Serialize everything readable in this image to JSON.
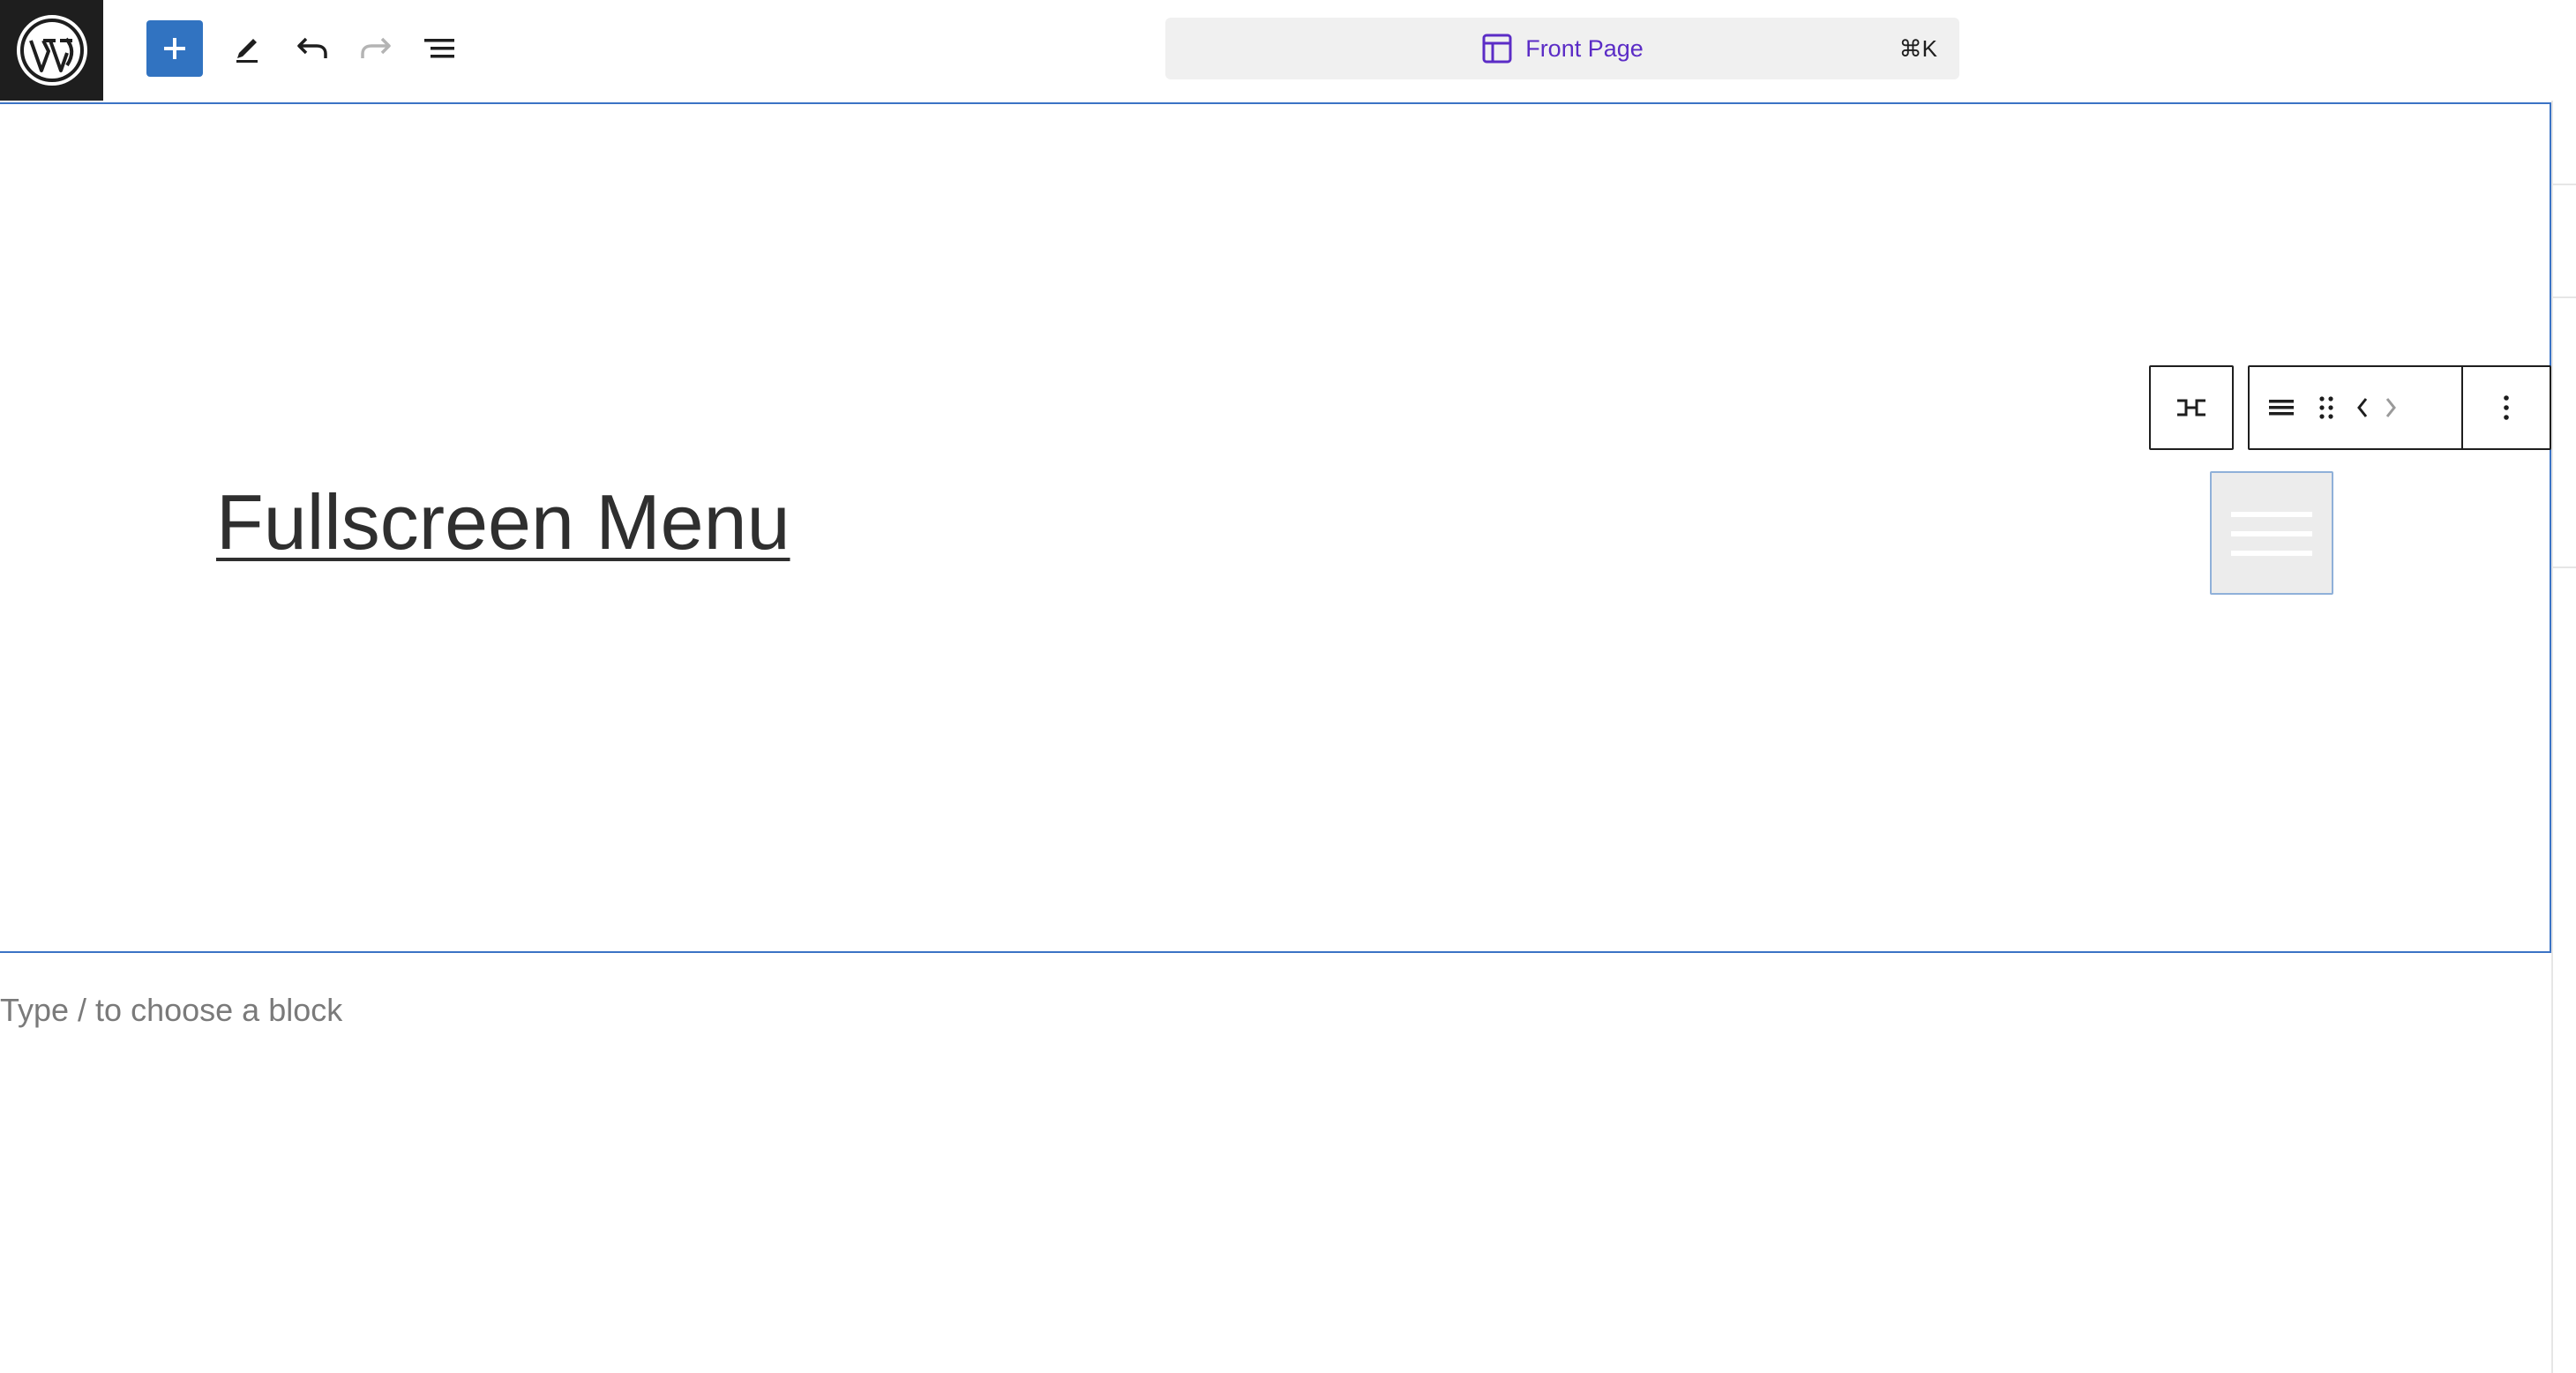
{
  "topbar": {
    "logo_icon": "wordpress-icon",
    "add_block_icon": "plus-icon",
    "tools_icon": "pencil-icon",
    "undo_icon": "undo-icon",
    "redo_icon": "redo-icon",
    "list_view_icon": "list-view-icon"
  },
  "command_bar": {
    "icon": "layout-icon",
    "title": "Front Page",
    "shortcut": "⌘K"
  },
  "canvas": {
    "site_title": "Fullscreen Menu",
    "appender_placeholder": "Type / to choose a block"
  },
  "block_toolbar": {
    "parent_icon": "navigation-parent-icon",
    "block_type_icon": "navigation-icon",
    "drag_icon": "drag-handle-icon",
    "move_left_icon": "chevron-left-icon",
    "move_right_icon": "chevron-right-icon",
    "options_icon": "more-vertical-icon"
  },
  "menu_toggle": {
    "icon": "hamburger-menu-icon"
  },
  "colors": {
    "accent": "#3173c1",
    "selection_border": "#3b73c5",
    "command_title": "#5b2cc6",
    "logo_bg": "#1e1e1e"
  }
}
